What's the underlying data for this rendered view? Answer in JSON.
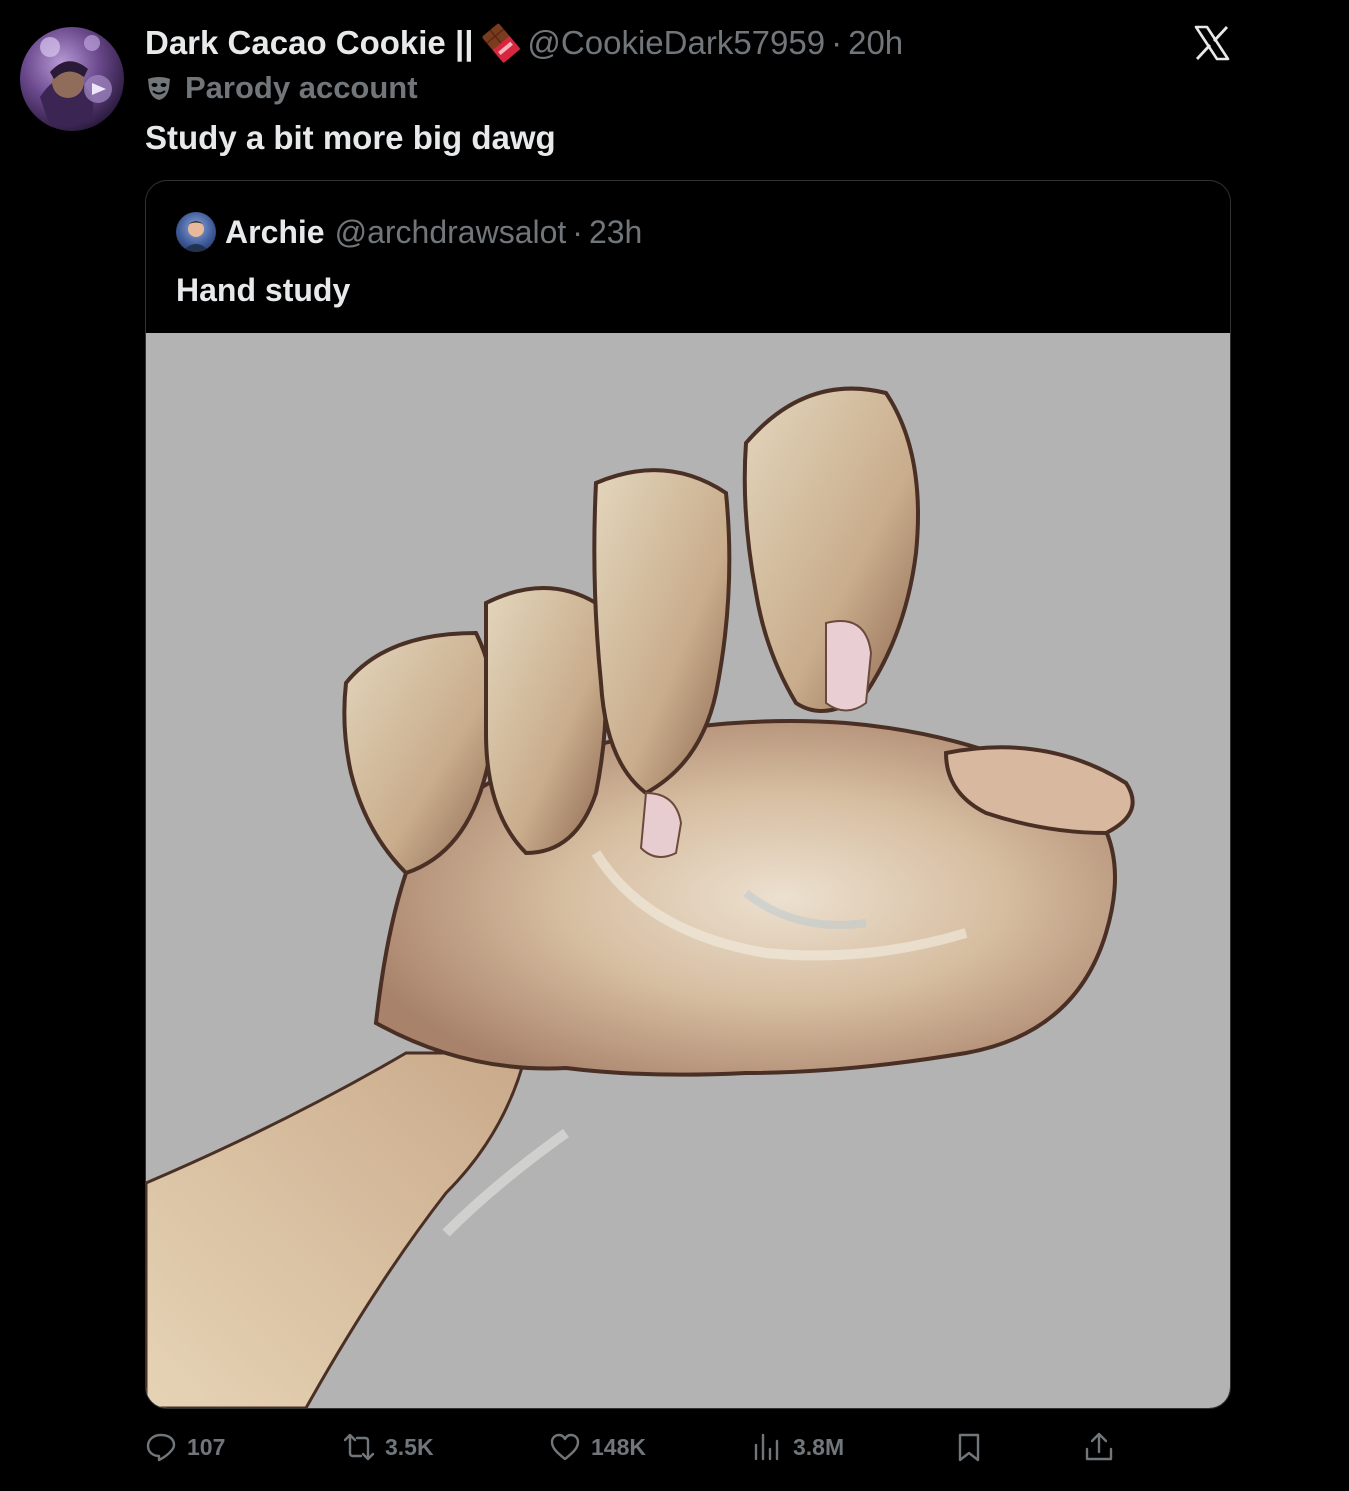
{
  "tweet": {
    "display_name": "Dark Cacao Cookie ||",
    "handle": "@CookieDark57959",
    "separator": "·",
    "time": "20h",
    "parody_label": "Parody account",
    "text": "Study a bit more big dawg"
  },
  "quote": {
    "display_name": "Archie",
    "handle": "@archdrawsalot",
    "separator": "·",
    "time": "23h",
    "text": "Hand study"
  },
  "actions": {
    "replies": "107",
    "reposts": "3.5K",
    "likes": "148K",
    "views": "3.8M"
  },
  "icons": {
    "logo": "x-logo-icon",
    "chocolate": "chocolate-bar-icon",
    "parody": "parody-mask-icon",
    "reply": "reply-icon",
    "repost": "repost-icon",
    "like": "heart-icon",
    "views": "views-icon",
    "bookmark": "bookmark-icon",
    "share": "share-icon"
  },
  "colors": {
    "background": "#000000",
    "primary_text": "#e7e9ea",
    "secondary_text": "#71767b",
    "border": "#2f3336",
    "media_background": "#b3b3b3"
  }
}
